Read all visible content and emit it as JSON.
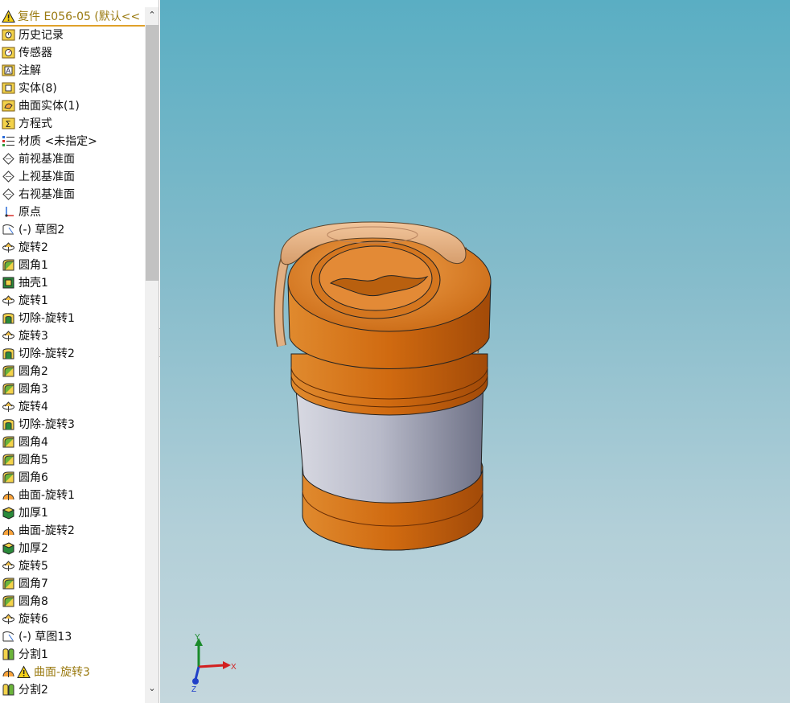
{
  "tree": {
    "header": {
      "title": "复件 E056-05  (默认<<",
      "icon": "warning-icon"
    },
    "items": [
      {
        "label": "历史记录",
        "icon": "history-icon"
      },
      {
        "label": "传感器",
        "icon": "sensor-icon"
      },
      {
        "label": "注解",
        "icon": "annotation-icon"
      },
      {
        "label": "实体(8)",
        "icon": "solid-bodies-icon"
      },
      {
        "label": "曲面实体(1)",
        "icon": "surface-bodies-icon"
      },
      {
        "label": "方程式",
        "icon": "equation-icon"
      },
      {
        "label": "材质 <未指定>",
        "icon": "material-icon"
      },
      {
        "label": "前视基准面",
        "icon": "plane-icon"
      },
      {
        "label": "上视基准面",
        "icon": "plane-icon"
      },
      {
        "label": "右视基准面",
        "icon": "plane-icon"
      },
      {
        "label": "原点",
        "icon": "origin-icon"
      },
      {
        "label": "(-) 草图2",
        "icon": "sketch-icon"
      },
      {
        "label": "旋转2",
        "icon": "revolve-icon"
      },
      {
        "label": "圆角1",
        "icon": "fillet-icon"
      },
      {
        "label": "抽壳1",
        "icon": "shell-icon"
      },
      {
        "label": "旋转1",
        "icon": "revolve-icon"
      },
      {
        "label": "切除-旋转1",
        "icon": "cut-revolve-icon"
      },
      {
        "label": "旋转3",
        "icon": "revolve-icon"
      },
      {
        "label": "切除-旋转2",
        "icon": "cut-revolve-icon"
      },
      {
        "label": "圆角2",
        "icon": "fillet-icon"
      },
      {
        "label": "圆角3",
        "icon": "fillet-icon"
      },
      {
        "label": "旋转4",
        "icon": "revolve-icon"
      },
      {
        "label": "切除-旋转3",
        "icon": "cut-revolve-icon"
      },
      {
        "label": "圆角4",
        "icon": "fillet-icon"
      },
      {
        "label": "圆角5",
        "icon": "fillet-icon"
      },
      {
        "label": "圆角6",
        "icon": "fillet-icon"
      },
      {
        "label": "曲面-旋转1",
        "icon": "surface-revolve-icon"
      },
      {
        "label": "加厚1",
        "icon": "thicken-icon"
      },
      {
        "label": "曲面-旋转2",
        "icon": "surface-revolve-icon"
      },
      {
        "label": "加厚2",
        "icon": "thicken-icon"
      },
      {
        "label": "旋转5",
        "icon": "revolve-icon"
      },
      {
        "label": "圆角7",
        "icon": "fillet-icon"
      },
      {
        "label": "圆角8",
        "icon": "fillet-icon"
      },
      {
        "label": "旋转6",
        "icon": "revolve-icon"
      },
      {
        "label": "(-) 草图13",
        "icon": "sketch-icon"
      },
      {
        "label": "分割1",
        "icon": "split-icon"
      },
      {
        "label": "曲面-旋转3",
        "icon": "surface-revolve-icon",
        "warning": true
      },
      {
        "label": "分割2",
        "icon": "split-icon"
      }
    ]
  },
  "triad": {
    "x_label": "X",
    "y_label": "Y",
    "z_label": "Z"
  },
  "colors": {
    "viewport_top": "#5aaec3",
    "viewport_bottom": "#c4d7dd",
    "model_orange": "#d9761c",
    "model_silver": "#b7b9c8",
    "header_text": "#9a7a10",
    "header_underline": "#e0a12a"
  }
}
